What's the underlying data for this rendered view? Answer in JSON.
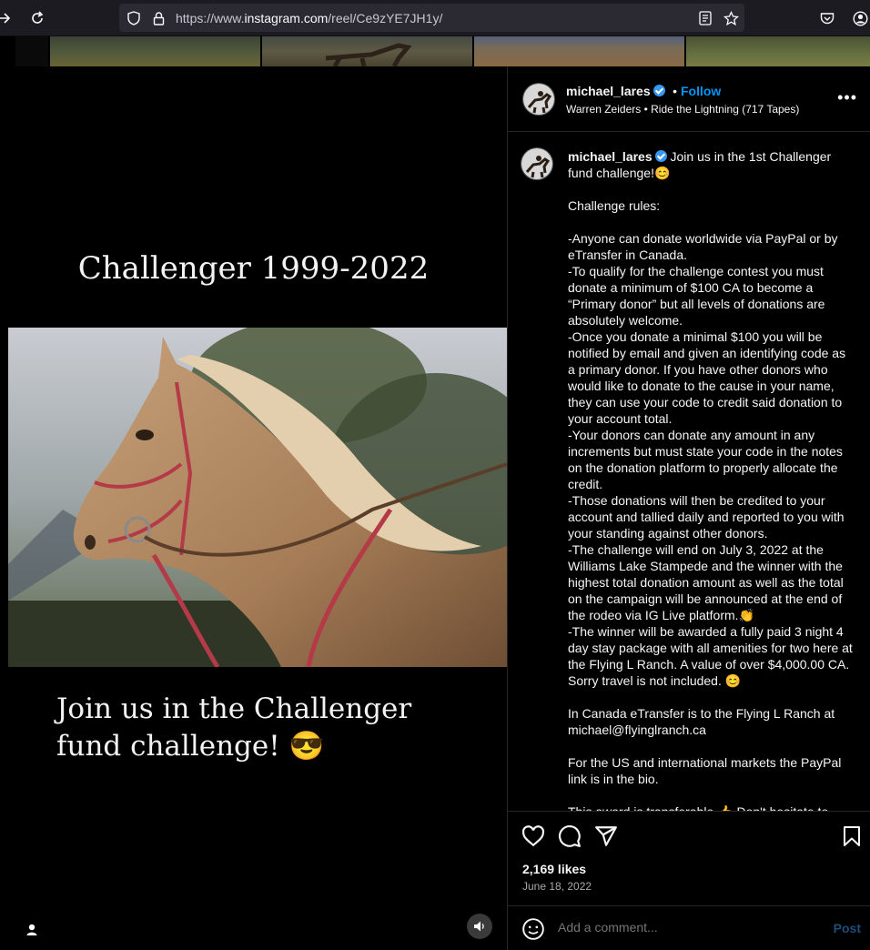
{
  "browser": {
    "url_prefix": "https://www.",
    "url_domain": "instagram.com",
    "url_path": "/reel/Ce9zYE7JH1y/"
  },
  "reel": {
    "title": "Challenger 1999-2022",
    "caption": "Join us in the Challenger fund challenge! 😎"
  },
  "post": {
    "username": "michael_lares",
    "follow_label": "Follow",
    "audio_artist": "Warren Zeiders",
    "audio_song": "Ride the Lightning (717 Tapes)",
    "more_label": "•••",
    "caption_intro": "Join us in the 1st Challenger fund challenge!😊",
    "caption_body": "Challenge rules:\n\n-Anyone can donate worldwide via PayPal or by eTransfer in Canada.\n-To qualify for the challenge contest you must donate a minimum of $100 CA to become a “Primary donor” but all levels of donations are absolutely welcome.\n-Once you donate a minimal $100 you will be notified by email and given an identifying code as a primary donor. If you have other donors who would like to donate to the cause in your name, they can use your code to credit said donation to your account total.\n-Your donors can donate any amount in any increments but must state your code in the notes on the donation platform to properly allocate the credit.\n-Those donations will then be credited to your account and tallied daily and reported to you with your standing against other donors.\n-The challenge will end on July 3, 2022 at the Williams Lake Stampede and the winner with the highest total donation amount as well as the total on the campaign will be announced at the end of the rodeo via IG Live platform.👏\n-The winner will be awarded a fully paid 3 night 4 day stay package with all amenities for two here at the Flying L Ranch. A value of over $4,000.00 CA. Sorry travel is not included. 😊\n\nIn Canada eTransfer is to the Flying L Ranch at michael@flyinglranch.ca\n\nFor the US and international markets the PayPal link is in the bio.\n\nThis award is transferable 👍 Don't hesitate to",
    "likes": "2,169 likes",
    "date": "June 18, 2022",
    "comment_placeholder": "Add a comment...",
    "post_label": "Post"
  },
  "colors": {
    "accent": "#0095f6",
    "verified": "#3897f0",
    "background": "#000000",
    "border": "#262626"
  },
  "icons": [
    "back-arrow-icon",
    "reload-icon",
    "shield-icon",
    "lock-icon",
    "reader-view-icon",
    "bookmark-star-icon",
    "pocket-icon",
    "account-icon",
    "heart-icon",
    "comment-icon",
    "share-icon",
    "save-icon",
    "emoji-icon",
    "person-icon",
    "audio-icon"
  ]
}
